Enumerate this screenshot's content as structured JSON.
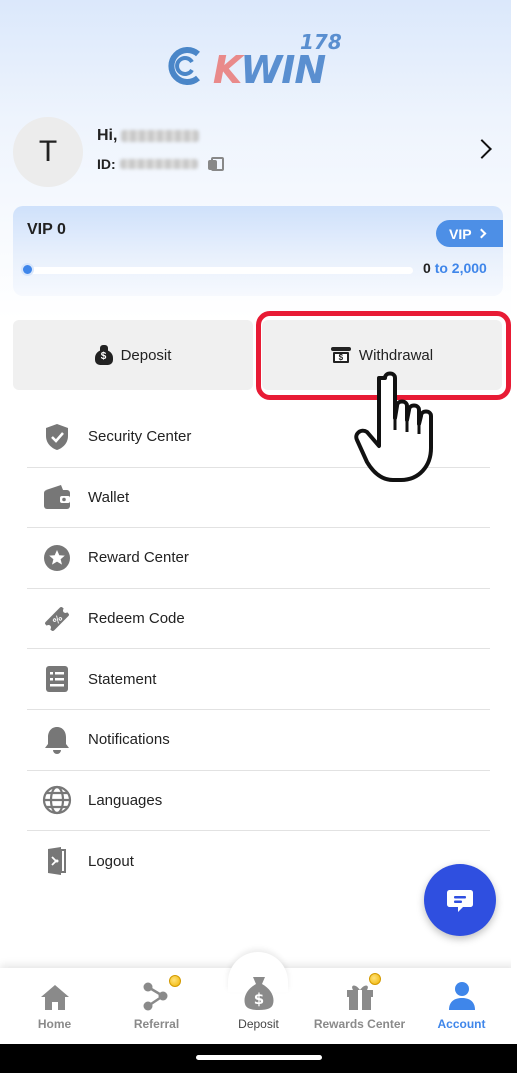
{
  "logo": {
    "part1": "C",
    "part2": "K",
    "part3": "WIN",
    "sup": "178"
  },
  "profile": {
    "avatar_letter": "T",
    "greeting": "Hi,",
    "id_label": "ID:"
  },
  "vip": {
    "title": "VIP 0",
    "button_label": "VIP",
    "progress_current": "0",
    "progress_target": "to 2,000",
    "progress_fraction": 0.0
  },
  "actions": {
    "deposit_label": "Deposit",
    "withdrawal_label": "Withdrawal"
  },
  "menu": {
    "items": [
      {
        "label": "Security Center",
        "icon": "shield-icon"
      },
      {
        "label": "Wallet",
        "icon": "wallet-icon"
      },
      {
        "label": "Reward Center",
        "icon": "star-icon"
      },
      {
        "label": "Redeem Code",
        "icon": "coupon-icon"
      },
      {
        "label": "Statement",
        "icon": "statement-icon"
      },
      {
        "label": "Notifications",
        "icon": "bell-icon"
      },
      {
        "label": "Languages",
        "icon": "globe-icon"
      },
      {
        "label": "Logout",
        "icon": "logout-icon"
      }
    ]
  },
  "bottom_nav": {
    "items": [
      {
        "label": "Home",
        "icon": "home-icon"
      },
      {
        "label": "Referral",
        "icon": "referral-icon"
      },
      {
        "label": "Deposit",
        "icon": "money-bag-icon"
      },
      {
        "label": "Rewards Center",
        "icon": "gift-icon"
      },
      {
        "label": "Account",
        "icon": "account-icon"
      }
    ],
    "active": "Account"
  },
  "colors": {
    "accent": "#3f86ea",
    "highlight": "#e81b35",
    "chat_fab": "#2f4fe0",
    "icon_gray": "#777777"
  }
}
